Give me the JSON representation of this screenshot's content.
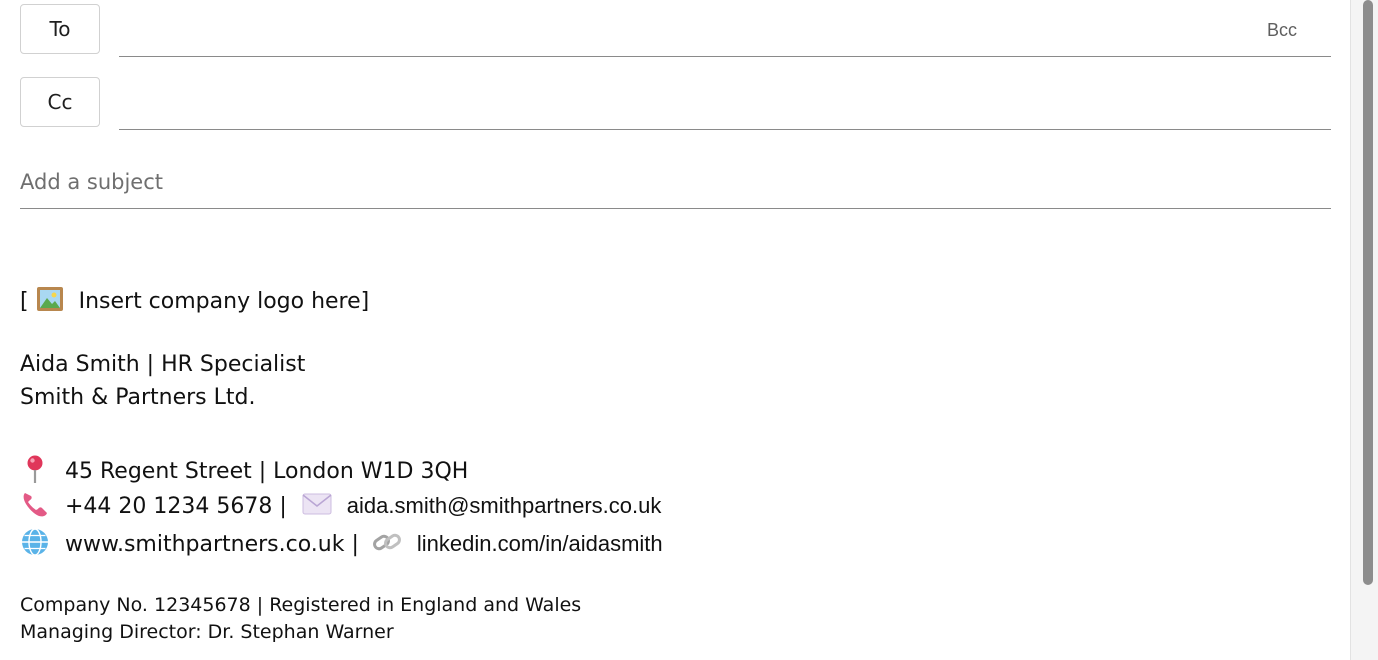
{
  "compose": {
    "to_label": "To",
    "cc_label": "Cc",
    "bcc_label": "Bcc",
    "to_value": "",
    "cc_value": "",
    "subject_placeholder": "Add a subject"
  },
  "signature": {
    "logo_open": "[",
    "logo_text": "Insert company logo here]",
    "name_line": "Aida Smith | HR Specialist",
    "company_line": "Smith & Partners Ltd.",
    "address": "45 Regent Street | London W1D 3QH",
    "phone": "+44 20 1234 5678 |",
    "email": "aida.smith@smithpartners.co.uk",
    "website": "www.smithpartners.co.uk |",
    "linkedin": "linkedin.com/in/aidasmith",
    "registration": "Company No. 12345678 | Registered in England and Wales",
    "director": "Managing Director: Dr. Stephan Warner",
    "icons": {
      "logo": "framed-picture-icon",
      "address": "pin-icon",
      "phone": "phone-icon",
      "email": "envelope-icon",
      "website": "globe-icon",
      "linkedin": "link-icon"
    }
  },
  "colors": {
    "field_border": "#8a8a8a",
    "button_border": "#d1d1d1",
    "placeholder": "#6f6f6f",
    "scrollbar_thumb": "#8d8d8d"
  }
}
